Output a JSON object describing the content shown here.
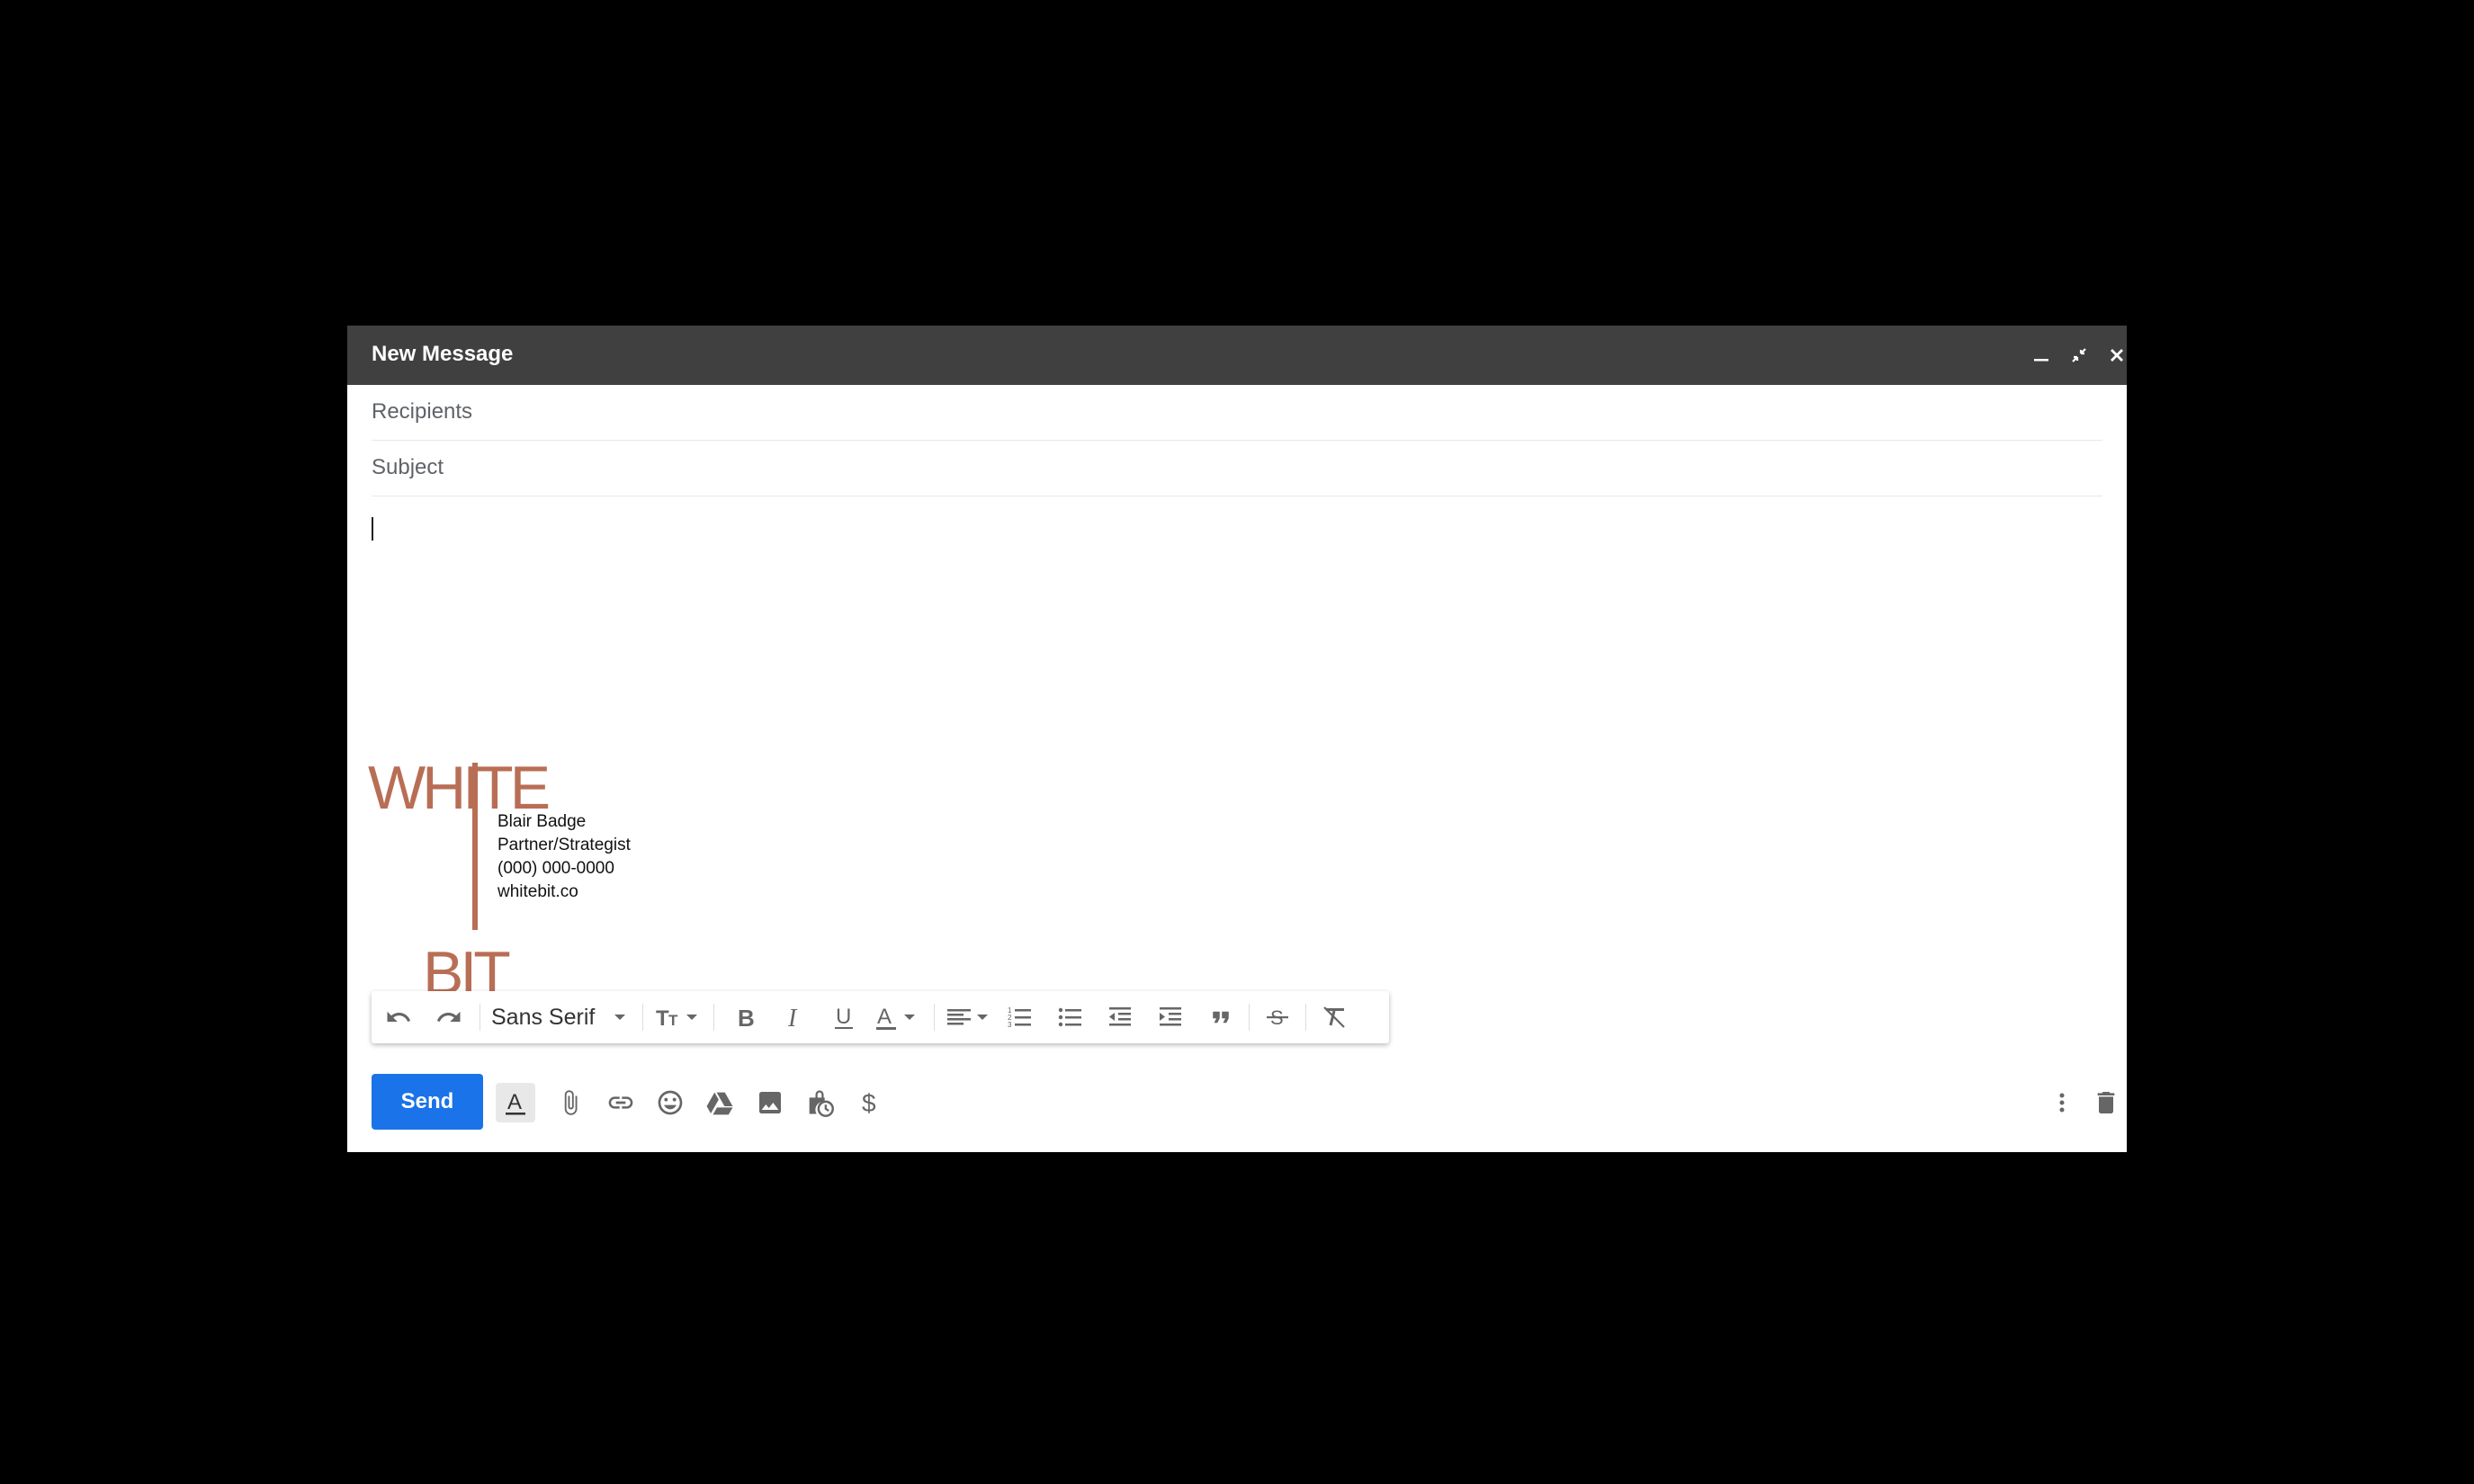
{
  "window": {
    "title": "New Message",
    "minimize_icon": "minimize-icon",
    "exit_fullscreen_icon": "exit-fullscreen-icon",
    "close_icon": "close-icon"
  },
  "fields": {
    "recipients_placeholder": "Recipients",
    "subject_placeholder": "Subject"
  },
  "signature": {
    "logo_top": "WHITE",
    "logo_bottom": "BIT",
    "name": "Blair Badge",
    "role": "Partner/Strategist",
    "phone": "(000) 000-0000",
    "website": "whitebit.co",
    "accent_color": "#b86e55"
  },
  "format_bar": {
    "font": "Sans Serif",
    "icons": [
      "undo-icon",
      "redo-icon",
      "font-size-icon",
      "bold-icon",
      "italic-icon",
      "underline-icon",
      "text-color-icon",
      "align-icon",
      "numbered-list-icon",
      "bulleted-list-icon",
      "indent-less-icon",
      "indent-more-icon",
      "quote-icon",
      "strikethrough-icon",
      "remove-formatting-icon"
    ]
  },
  "bottom_bar": {
    "send_label": "Send",
    "send_color": "#1a73e8",
    "icons": [
      "formatting-options-icon",
      "attach-icon",
      "link-icon",
      "emoji-icon",
      "drive-icon",
      "photo-icon",
      "confidential-icon",
      "money-icon",
      "more-options-icon",
      "discard-icon"
    ]
  }
}
